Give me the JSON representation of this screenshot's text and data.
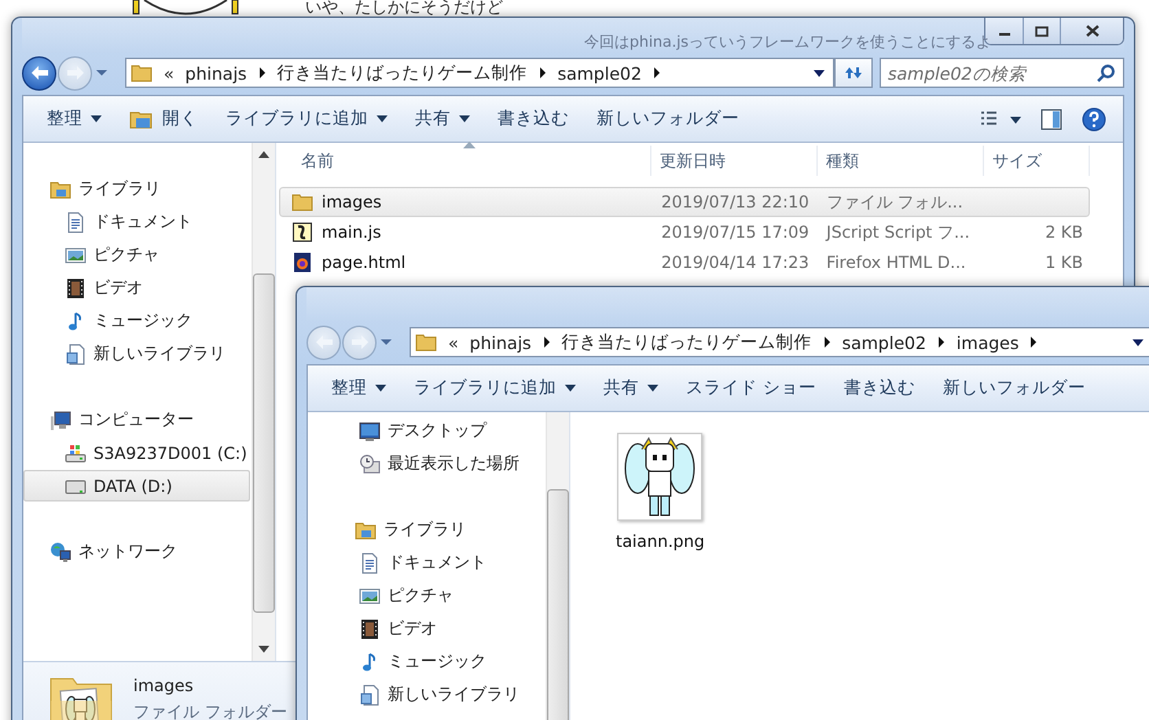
{
  "background_texts": [
    "いや、たしかにそうだけど",
    "今回はphina.jsっていうフレームワークを使うことにするよ"
  ],
  "windows": [
    {
      "kind": "details",
      "caption_buttons": true,
      "back_enabled": true,
      "forward_enabled": false,
      "address": {
        "overflow": "«",
        "path": [
          "phinajs",
          "行き当たりばったりゲーム制作",
          "sample02"
        ]
      },
      "search": {
        "placeholder": "sample02の検索"
      },
      "toolbar": [
        {
          "label": "整理",
          "kind": "menu"
        },
        {
          "label": "開く",
          "kind": "open"
        },
        {
          "label": "ライブラリに追加",
          "kind": "menu"
        },
        {
          "label": "共有",
          "kind": "menu"
        },
        {
          "label": "書き込む",
          "kind": "command"
        },
        {
          "label": "新しいフォルダー",
          "kind": "command"
        }
      ],
      "toolbar_tools": true,
      "nav": [
        {
          "label": "ライブラリ",
          "kind": "library",
          "selected": false,
          "children": [
            {
              "label": "ドキュメント",
              "kind": "documents",
              "selected": false
            },
            {
              "label": "ピクチャ",
              "kind": "pictures",
              "selected": false
            },
            {
              "label": "ビデオ",
              "kind": "videos",
              "selected": false
            },
            {
              "label": "ミュージック",
              "kind": "music",
              "selected": false
            },
            {
              "label": "新しいライブラリ",
              "kind": "new-library",
              "selected": false
            }
          ]
        },
        {
          "label": "コンピューター",
          "kind": "computer",
          "selected": false,
          "children": [
            {
              "label": "S3A9237D001 (C:)",
              "kind": "system-drive",
              "selected": false
            },
            {
              "label": "DATA (D:)",
              "kind": "drive",
              "selected": true
            }
          ]
        },
        {
          "label": "ネットワーク",
          "kind": "network",
          "selected": false
        }
      ],
      "columns": [
        {
          "label": "名前",
          "sorted": true
        },
        {
          "label": "更新日時",
          "sorted": false
        },
        {
          "label": "種類",
          "sorted": false
        },
        {
          "label": "サイズ",
          "sorted": false
        }
      ],
      "rows": [
        {
          "name": "images",
          "kind": "folder",
          "date": "2019/07/13 22:10",
          "type": "ファイル フォル...",
          "size": "",
          "selected": true
        },
        {
          "name": "main.js",
          "kind": "script",
          "date": "2019/07/15 17:09",
          "type": "JScript Script フ...",
          "size": "2 KB",
          "selected": false
        },
        {
          "name": "page.html",
          "kind": "web-page",
          "date": "2019/04/14 17:23",
          "type": "Firefox HTML D...",
          "size": "1 KB",
          "selected": false
        }
      ],
      "details": {
        "name": "images",
        "type": "ファイル フォルダー"
      }
    },
    {
      "kind": "icons",
      "caption_buttons": false,
      "back_enabled": false,
      "forward_enabled": false,
      "address": {
        "overflow": "«",
        "path": [
          "phinajs",
          "行き当たりばったりゲーム制作",
          "sample02",
          "images"
        ]
      },
      "toolbar": [
        {
          "label": "整理",
          "kind": "menu"
        },
        {
          "label": "ライブラリに追加",
          "kind": "menu"
        },
        {
          "label": "共有",
          "kind": "menu"
        },
        {
          "label": "スライド ショー",
          "kind": "command"
        },
        {
          "label": "書き込む",
          "kind": "command"
        },
        {
          "label": "新しいフォルダー",
          "kind": "command"
        }
      ],
      "toolbar_tools": false,
      "nav": [
        {
          "label": "デスクトップ",
          "kind": "desktop",
          "selected": false
        },
        {
          "label": "最近表示した場所",
          "kind": "recent",
          "selected": false
        },
        {
          "label": "ライブラリ",
          "kind": "library",
          "selected": false,
          "children": [
            {
              "label": "ドキュメント",
              "kind": "documents",
              "selected": false
            },
            {
              "label": "ピクチャ",
              "kind": "pictures",
              "selected": false
            },
            {
              "label": "ビデオ",
              "kind": "videos",
              "selected": false
            },
            {
              "label": "ミュージック",
              "kind": "music",
              "selected": false
            },
            {
              "label": "新しいライブラリ",
              "kind": "new-library",
              "selected": false
            }
          ]
        }
      ],
      "items": [
        {
          "name": "taiann.png",
          "kind": "image",
          "selected": false
        }
      ]
    }
  ]
}
